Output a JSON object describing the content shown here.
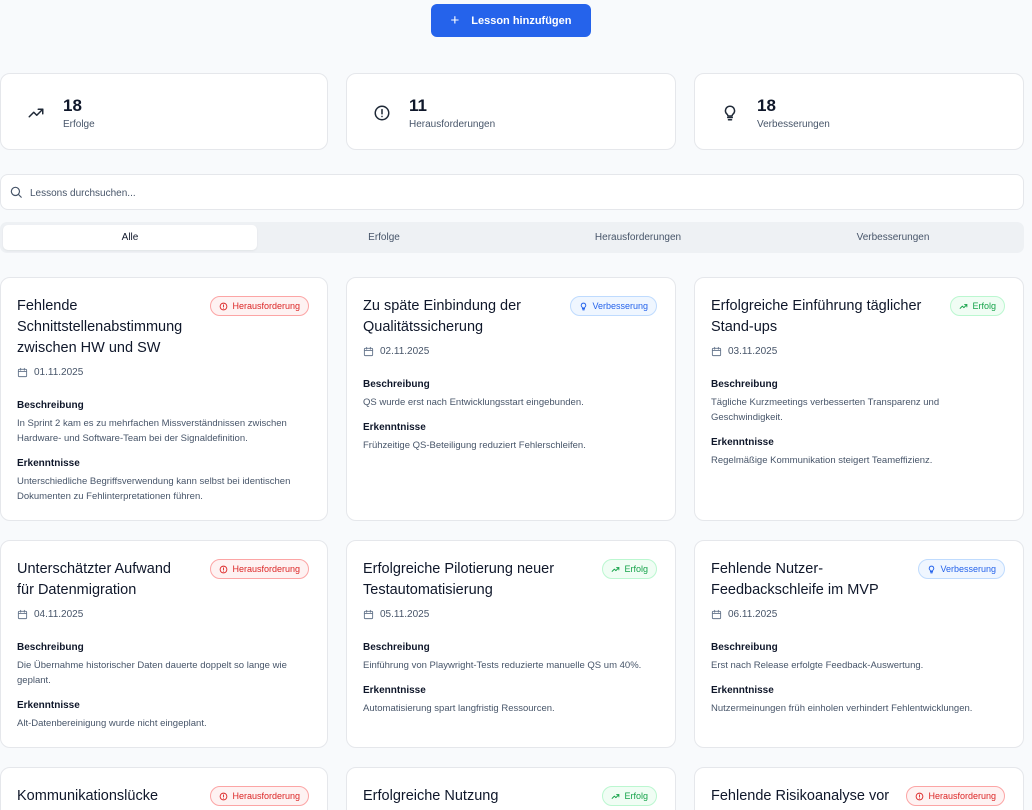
{
  "add_button": {
    "label": "Lesson hinzufügen",
    "icon": "plus-icon"
  },
  "stats": [
    {
      "value": "18",
      "label": "Erfolge",
      "icon": "trending-up-icon"
    },
    {
      "value": "11",
      "label": "Herausforderungen",
      "icon": "alert-circle-icon"
    },
    {
      "value": "18",
      "label": "Verbesserungen",
      "icon": "lightbulb-icon"
    }
  ],
  "search": {
    "placeholder": "Lessons durchsuchen...",
    "value": ""
  },
  "tabs": [
    {
      "label": "Alle",
      "active": true
    },
    {
      "label": "Erfolge",
      "active": false
    },
    {
      "label": "Herausforderungen",
      "active": false
    },
    {
      "label": "Verbesserungen",
      "active": false
    }
  ],
  "section_labels": {
    "beschreibung": "Beschreibung",
    "erkenntnisse": "Erkenntnisse"
  },
  "cards": [
    {
      "title": "Fehlende Schnittstellenabstimmung zwischen HW und SW",
      "badge": "Herausforderung",
      "badge_type": "h",
      "date": "01.11.2025",
      "beschreibung": "In Sprint 2 kam es zu mehrfachen Missverständnissen zwischen Hardware- und Software-Team bei der Signaldefinition.",
      "erkenntnisse": "Unterschiedliche Begriffsverwendung kann selbst bei identischen Dokumenten zu Fehlinterpretationen führen."
    },
    {
      "title": "Zu späte Einbindung der Qualitätssicherung",
      "badge": "Verbesserung",
      "badge_type": "v",
      "date": "02.11.2025",
      "beschreibung": "QS wurde erst nach Entwicklungsstart eingebunden.",
      "erkenntnisse": "Frühzeitige QS-Beteiligung reduziert Fehlerschleifen."
    },
    {
      "title": "Erfolgreiche Einführung täglicher Stand-ups",
      "badge": "Erfolg",
      "badge_type": "e",
      "date": "03.11.2025",
      "beschreibung": "Tägliche Kurzmeetings verbesserten Transparenz und Geschwindigkeit.",
      "erkenntnisse": "Regelmäßige Kommunikation steigert Teameffizienz."
    },
    {
      "title": "Unterschätzter Aufwand für Datenmigration",
      "badge": "Herausforderung",
      "badge_type": "h",
      "date": "04.11.2025",
      "beschreibung": "Die Übernahme historischer Daten dauerte doppelt so lange wie geplant.",
      "erkenntnisse": "Alt-Datenbereinigung wurde nicht eingeplant."
    },
    {
      "title": "Erfolgreiche Pilotierung neuer Testautomatisierung",
      "badge": "Erfolg",
      "badge_type": "e",
      "date": "05.11.2025",
      "beschreibung": "Einführung von Playwright-Tests reduzierte manuelle QS um 40%.",
      "erkenntnisse": "Automatisierung spart langfristig Ressourcen."
    },
    {
      "title": "Fehlende Nutzer-Feedbackschleife im MVP",
      "badge": "Verbesserung",
      "badge_type": "v",
      "date": "06.11.2025",
      "beschreibung": "Erst nach Release erfolgte Feedback-Auswertung.",
      "erkenntnisse": "Nutzermeinungen früh einholen verhindert Fehlentwicklungen."
    },
    {
      "title": "Kommunikationslücke",
      "badge": "Herausforderung",
      "badge_type": "h"
    },
    {
      "title": "Erfolgreiche Nutzung",
      "badge": "Erfolg",
      "badge_type": "e"
    },
    {
      "title": "Fehlende Risikoanalyse vor",
      "badge": "Herausforderung",
      "badge_type": "h"
    }
  ]
}
